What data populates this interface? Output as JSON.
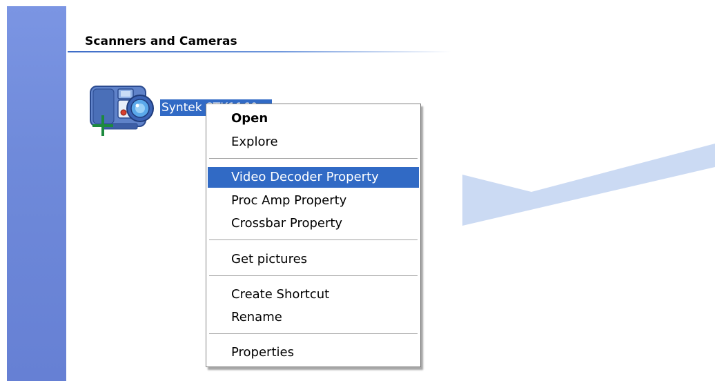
{
  "panel": {
    "group_title": "Scanners and Cameras",
    "device": {
      "label": "Syntek STK1160",
      "icon": "camera-icon"
    }
  },
  "context_menu": {
    "items": [
      {
        "label": "Open",
        "bold": true
      },
      {
        "label": "Explore"
      },
      {
        "label": "Video Decoder Property",
        "selected": true
      },
      {
        "label": "Proc Amp Property"
      },
      {
        "label": "Crossbar Property"
      },
      {
        "label": "Get pictures"
      },
      {
        "label": "Create Shortcut"
      },
      {
        "label": "Rename"
      },
      {
        "label": "Properties"
      }
    ]
  },
  "colors": {
    "selection": "#316ac5",
    "task_pane": "#7089d9",
    "decor_arrow": "#cbdaf3"
  }
}
